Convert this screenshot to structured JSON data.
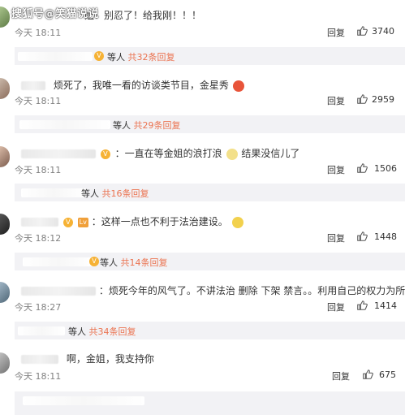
{
  "watermark": "搜狐号@笑猫说说",
  "comments": [
    {
      "text": "姐！别忍了！给我刚！！！",
      "time": "今天 18:11",
      "reply_label": "回复",
      "likes": "3740",
      "sub": {
        "suffix": "等人",
        "count": "共32条回复"
      }
    },
    {
      "text": "烦死了，我唯一看的访谈类节目，金星秀",
      "time": "今天 18:11",
      "reply_label": "回复",
      "likes": "2959",
      "sub": {
        "suffix": "等人",
        "count": "共29条回复"
      }
    },
    {
      "text_a": "：一直在等金姐的浪打浪",
      "text_b": "结果没信儿了",
      "time": "今天 18:11",
      "reply_label": "回复",
      "likes": "1506",
      "sub": {
        "suffix": "等人",
        "count": "共16条回复"
      }
    },
    {
      "text": "：这样一点也不利于法治建设。",
      "time": "今天 18:12",
      "reply_label": "回复",
      "likes": "1448",
      "sub": {
        "suffix": "等人",
        "count": "共14条回复"
      }
    },
    {
      "text": "：烦死今年的风气了。不讲法治 删除 下架 禁言。。利用自己的权力为所欲为",
      "time": "今天 18:27",
      "reply_label": "回复",
      "likes": "1414",
      "sub": {
        "suffix": "等人",
        "count": "共34条回复"
      }
    },
    {
      "text": "啊，金姐，我支持你",
      "time": "今天 18:11",
      "reply_label": "回复",
      "likes": "675"
    }
  ],
  "colors": {
    "accent": "#eb7350",
    "meta": "#808080",
    "subbox_bg": "#f2f2f5"
  },
  "icons": [
    "thumbs-up-icon",
    "v-badge-icon",
    "emoji-icon"
  ]
}
